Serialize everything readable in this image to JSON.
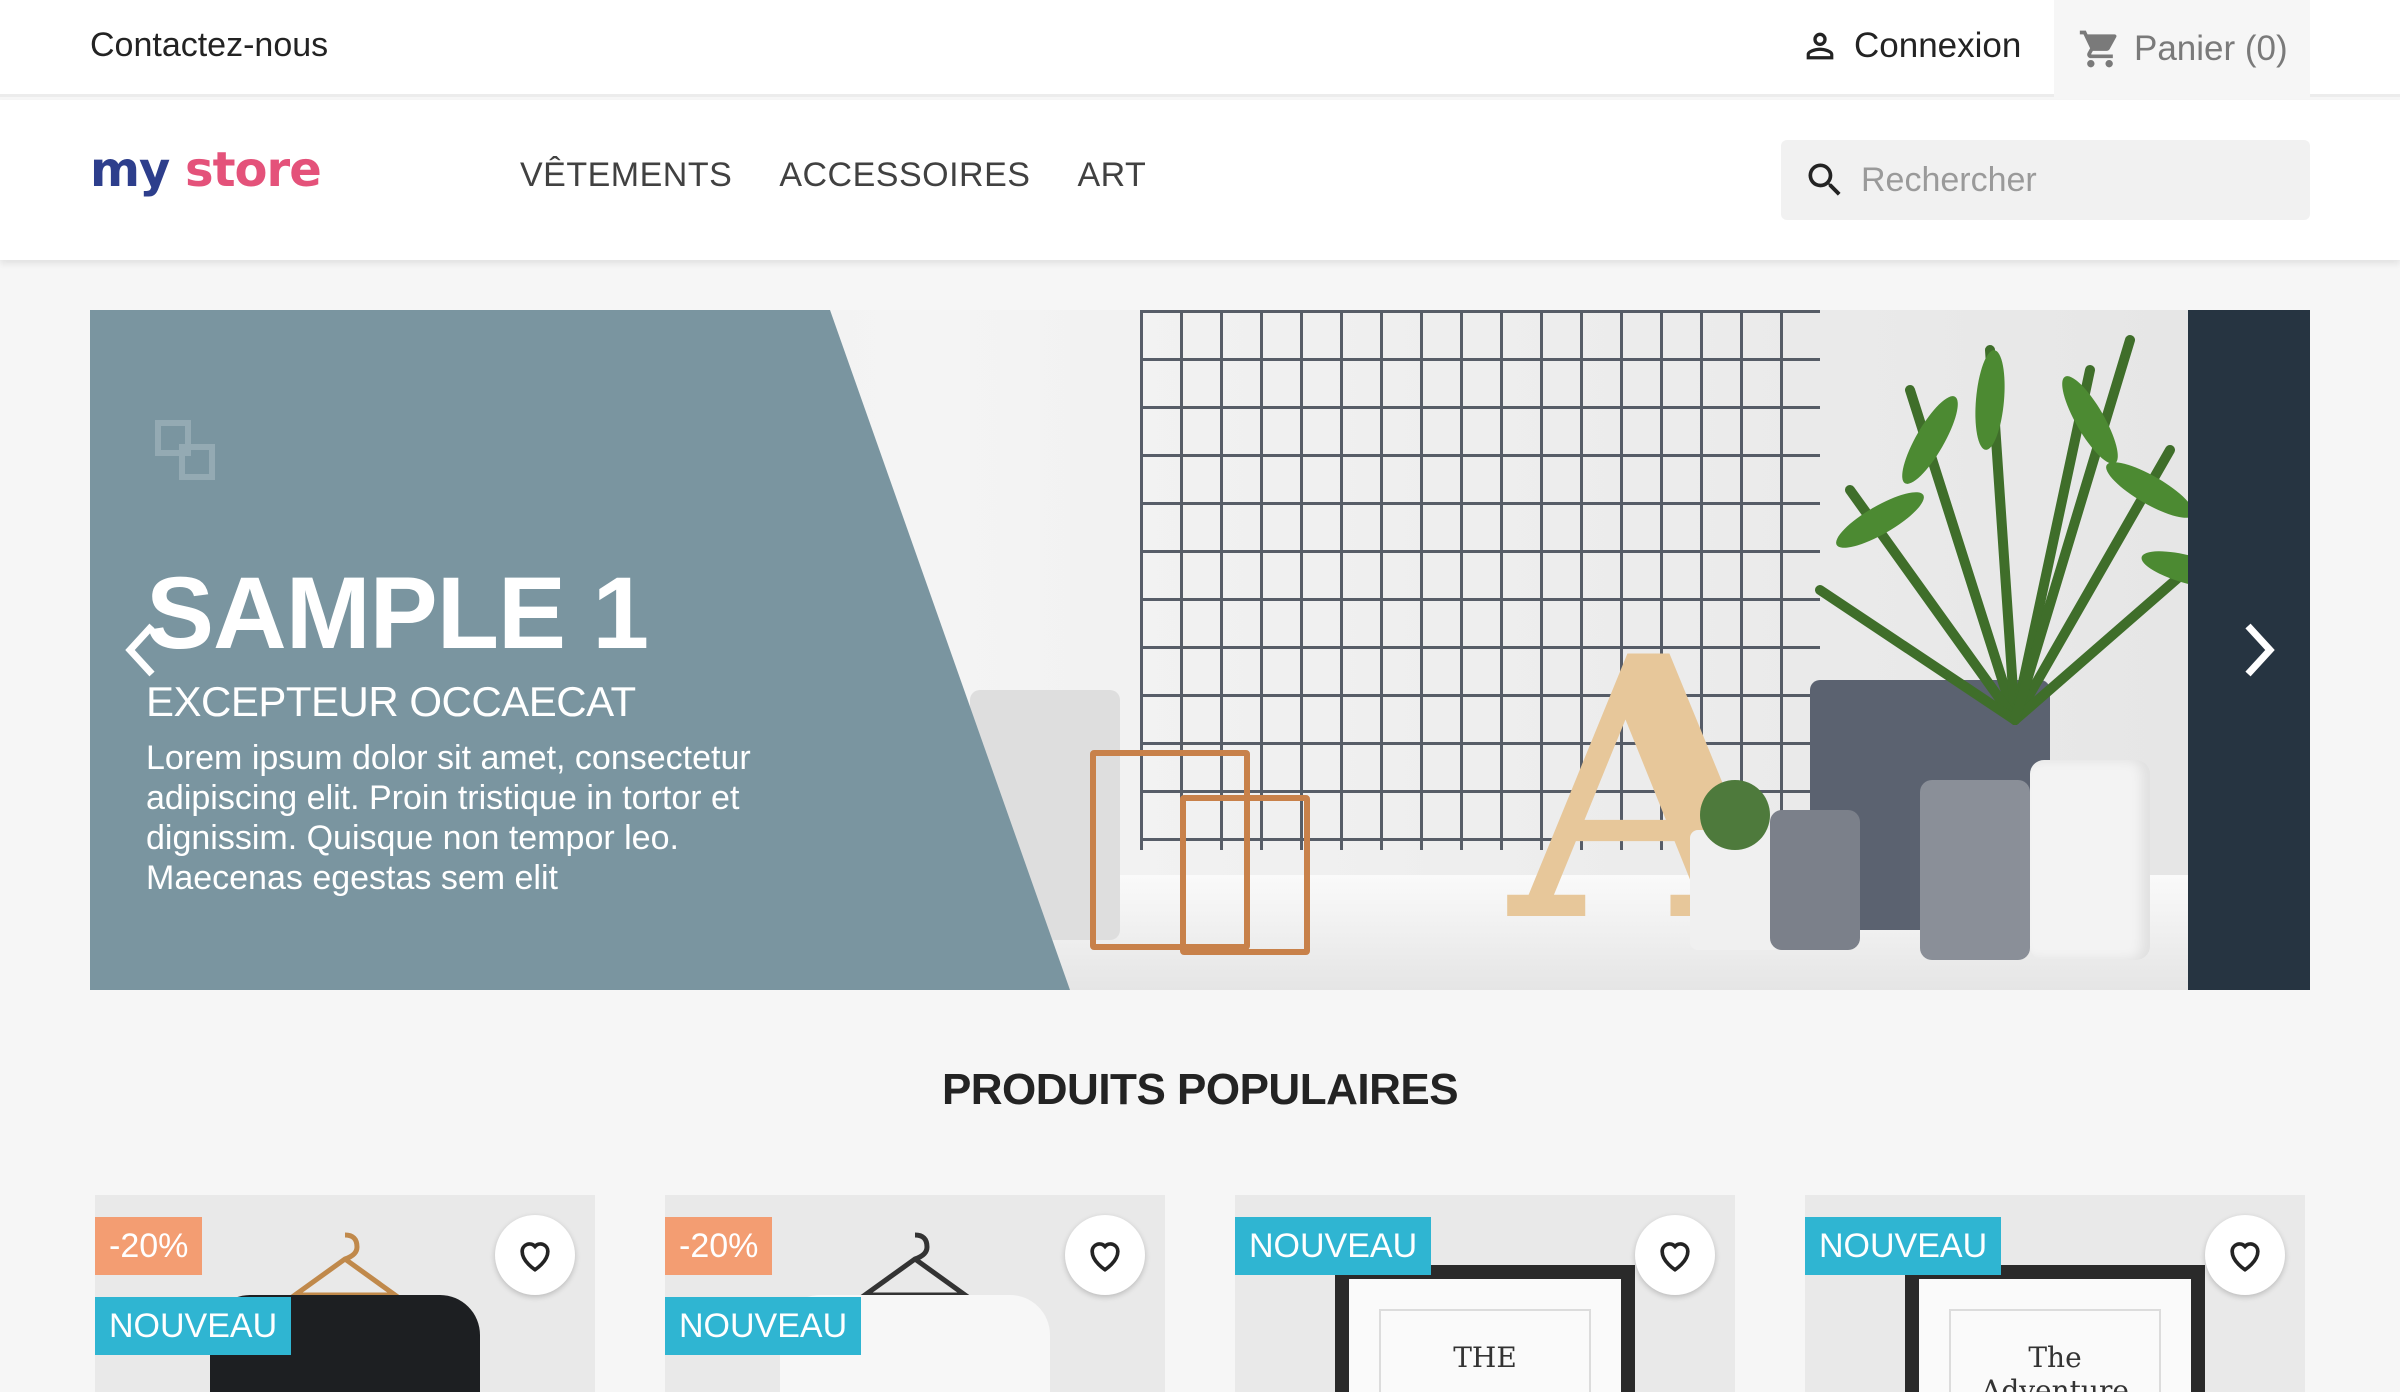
{
  "topbar": {
    "contact": "Contactez-nous",
    "login": "Connexion",
    "cart": "Panier (0)"
  },
  "header": {
    "logo": {
      "my": "my",
      "store": "store"
    },
    "nav": [
      "VÊTEMENTS",
      "ACCESSOIRES",
      "ART"
    ],
    "search_placeholder": "Rechercher"
  },
  "slider": {
    "title": "SAMPLE 1",
    "subtitle": "EXCEPTEUR OCCAECAT",
    "text": "Lorem ipsum dolor sit amet, consectetur adipiscing elit. Proin tristique in tortor et dignissim. Quisque non tempor leo. Maecenas egestas sem elit"
  },
  "section_title": "PRODUITS POPULAIRES",
  "products": [
    {
      "discount": "-20%",
      "flag": "NOUVEAU"
    },
    {
      "discount": "-20%",
      "flag": "NOUVEAU"
    },
    {
      "flag": "NOUVEAU",
      "frame_text": "THE"
    },
    {
      "flag": "NOUVEAU",
      "frame_text": "The Adventure"
    }
  ],
  "colors": {
    "accent": "#2fb5d2",
    "discount": "#f39d72",
    "slide_overlay": "#7a95a0"
  }
}
